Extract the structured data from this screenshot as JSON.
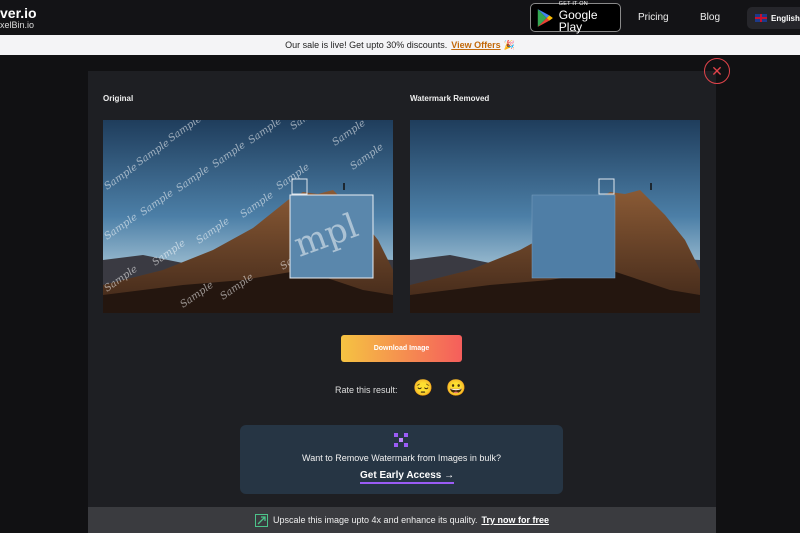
{
  "header": {
    "logo_line1": "ver.io",
    "logo_line2": "xelBin.io",
    "gplay_small": "GET IT ON",
    "gplay_big": "Google Play",
    "nav": {
      "pricing": "Pricing",
      "blog": "Blog"
    },
    "language": "English"
  },
  "banner": {
    "text": "Our sale is live! Get upto 30% discounts.",
    "link": "View Offers",
    "emoji": "🎉"
  },
  "comparison": {
    "original_label": "Original",
    "result_label": "Watermark Removed",
    "watermark_text": "Sample",
    "zoom_text": "mpl"
  },
  "actions": {
    "download_label": "Download Image",
    "rate_label": "Rate this result:",
    "emoji_bad": "😔",
    "emoji_good": "😀"
  },
  "bulk": {
    "text": "Want to Remove Watermark from Images in bulk?",
    "cta": "Get Early Access →"
  },
  "upscale": {
    "text": "Upscale this image upto 4x and enhance its quality.",
    "link": "Try now for free"
  },
  "colors": {
    "accent": "#e0434a",
    "gradient_start": "#f5c342",
    "gradient_end": "#f55e5c",
    "bulk_bg": "#263544"
  }
}
